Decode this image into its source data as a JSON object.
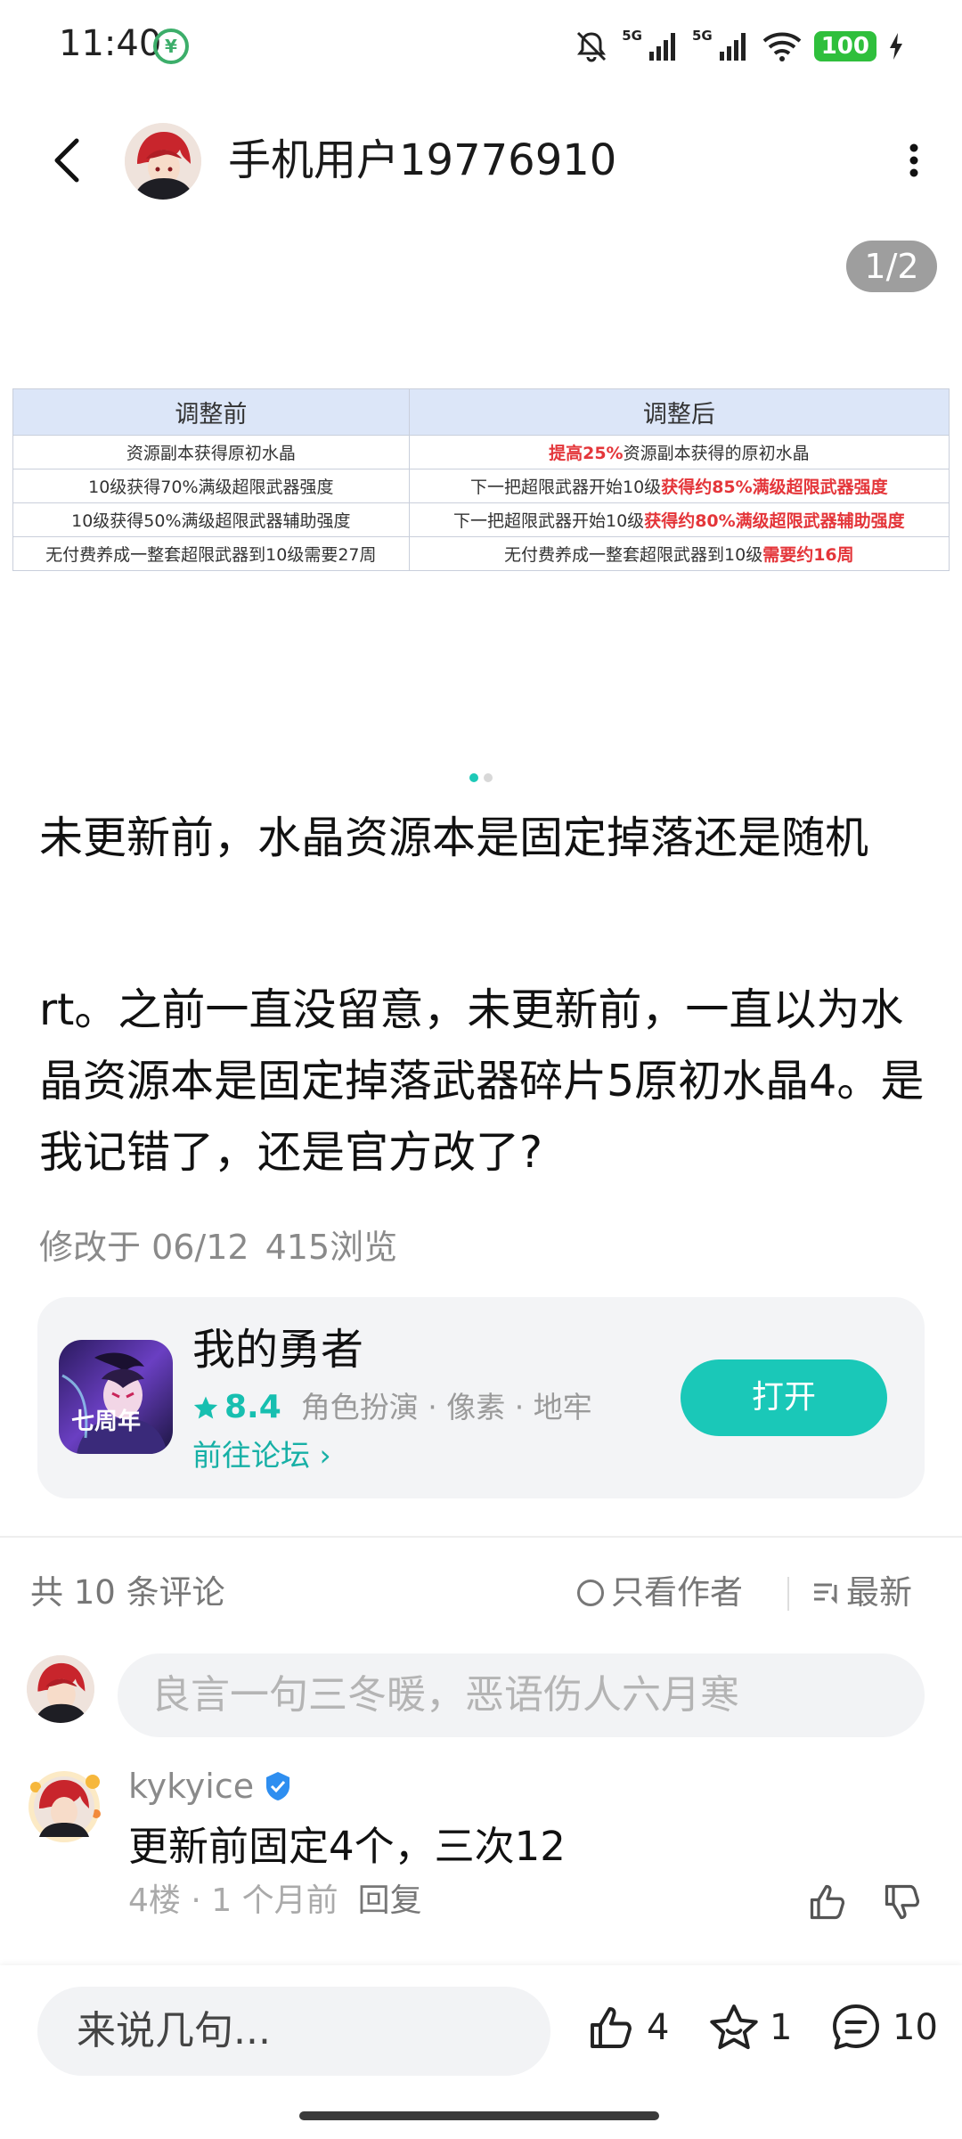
{
  "status_bar": {
    "time": "11:40",
    "net1": "5G",
    "net2": "5G",
    "battery": "100"
  },
  "header": {
    "username": "手机用户19776910"
  },
  "carousel": {
    "counter": "1/2",
    "table": {
      "headers": [
        "调整前",
        "调整后"
      ],
      "rows": [
        {
          "before": "资源副本获得原初水晶",
          "after_hl": "提高25%",
          "after_rest": "资源副本获得的原初水晶"
        },
        {
          "before": "10级获得70%满级超限武器强度",
          "after_pre": "下一把超限武器开始10级",
          "after_hl": "获得约85%满级超限武器强度"
        },
        {
          "before": "10级获得50%满级超限武器辅助强度",
          "after_pre": "下一把超限武器开始10级",
          "after_hl": "获得约80%满级超限武器辅助强度"
        },
        {
          "before": "无付费养成一整套超限武器到10级需要27周",
          "after_pre": "无付费养成一整套超限武器到10级",
          "after_hl": "需要约16周"
        }
      ]
    }
  },
  "post": {
    "title": "未更新前，水晶资源本是固定掉落还是随机",
    "body": "rt。之前一直没留意，未更新前，一直以为水晶资源本是固定掉落武器碎片5原初水晶4。是我记错了，还是官方改了?",
    "modified": "修改于 06/12",
    "views": "415浏览"
  },
  "game_card": {
    "name": "我的勇者",
    "rating": "8.4",
    "tags": "角色扮演 · 像素 · 地牢",
    "forum_link": "前往论坛 ›",
    "open_label": "打开",
    "icon_text": "七周年"
  },
  "comments": {
    "count_label": "共 10 条评论",
    "only_author": "只看作者",
    "sort": "最新",
    "input_placeholder": "良言一句三冬暖，恶语伤人六月寒",
    "items": [
      {
        "user": "kykyice",
        "text": "更新前固定4个，三次12",
        "meta": "4楼 · 1 个月前",
        "reply": "回复"
      }
    ]
  },
  "bottom_bar": {
    "placeholder": "来说几句...",
    "likes": "4",
    "favorites": "1",
    "comments": "10"
  },
  "colors": {
    "accent": "#1ac8b8",
    "highlight_red": "#e4363a",
    "table_header_bg": "#dce6f8",
    "card_bg": "#f3f4f6"
  }
}
